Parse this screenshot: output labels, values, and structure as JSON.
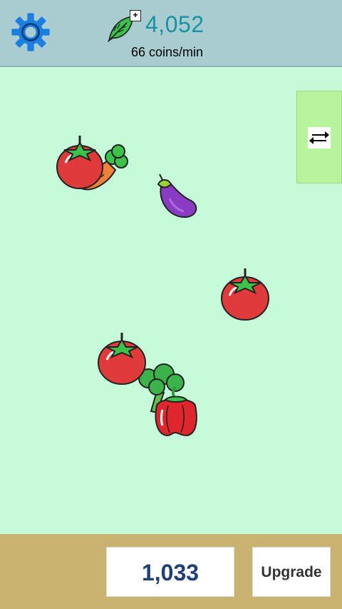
{
  "header": {
    "coins": "4,052",
    "rate": "66 coins/min",
    "plus_label": "+"
  },
  "game": {
    "vegetables": [
      "tomato",
      "carrot",
      "eggplant",
      "tomato",
      "tomato",
      "broccoli",
      "red-pepper"
    ]
  },
  "footer": {
    "upgrade_cost": "1,033",
    "upgrade_label": "Upgrade"
  },
  "colors": {
    "header_bg": "#a9ccd1",
    "play_bg": "#c6fbd9",
    "footer_bg": "#c8b470",
    "coin_text": "#1793a3",
    "cost_text": "#1e3f7a",
    "gear": "#1a7fe0"
  },
  "icons": [
    "gear-icon",
    "leaf-coin-icon",
    "plus-icon",
    "swap-arrows-icon"
  ]
}
